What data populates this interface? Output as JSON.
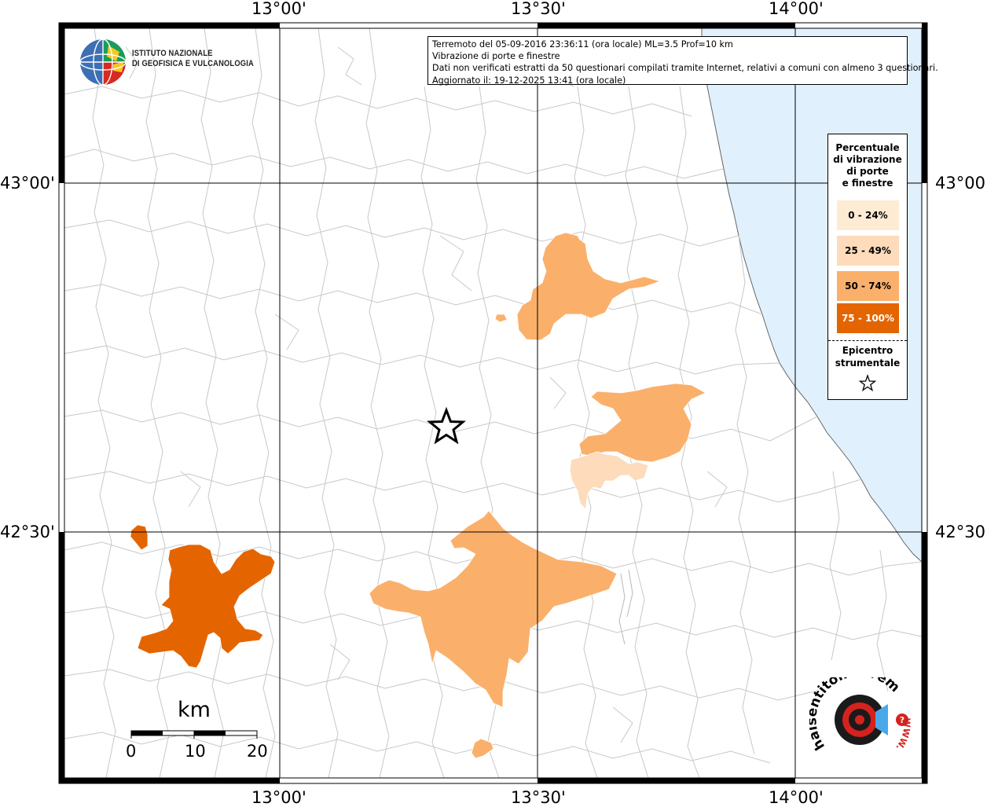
{
  "map": {
    "lon_labels": [
      "13°00'",
      "13°30'",
      "14°00'"
    ],
    "lat_labels": [
      "43°00'",
      "42°30'"
    ],
    "colors": {
      "sea": "#e0f0fc",
      "class_25_49": "#fddbbb",
      "class_50_74": "#fab06b",
      "class_75_100": "#e46500"
    }
  },
  "institute": {
    "line1": "ISTITUTO NAZIONALE",
    "line2": "DI GEOFISICA E VULCANOLOGIA"
  },
  "info": {
    "line1": "Terremoto del 05-09-2016 23:36:11 (ora locale) ML=3.5 Prof=10 km",
    "line2": "Vibrazione di porte e finestre",
    "line3": "Dati non verificati estratti da 50 questionari compilati tramite Internet, relativi a comuni con almeno 3 questionari.",
    "line4": "Aggiornato il: 19-12-2025 13:41 (ora locale)"
  },
  "legend": {
    "title_lines": [
      "Percentuale",
      "di vibrazione",
      "di porte",
      "e finestre"
    ],
    "items": [
      {
        "label": "0 - 24%",
        "color": "#fdebd3",
        "text_color": "#000000"
      },
      {
        "label": "25 - 49%",
        "color": "#fddbbb",
        "text_color": "#000000"
      },
      {
        "label": "50 - 74%",
        "color": "#fab06b",
        "text_color": "#000000"
      },
      {
        "label": "75 - 100%",
        "color": "#e46500",
        "text_color": "#ffffff"
      }
    ],
    "epicenter_lines": [
      "Epicentro",
      "strumentale"
    ]
  },
  "scale_bar": {
    "title": "km",
    "labels": [
      "0",
      "10",
      "20"
    ]
  },
  "hsi_logo": {
    "text": "haisentitoilterremoto.it",
    "url_prefix": "WWW."
  }
}
